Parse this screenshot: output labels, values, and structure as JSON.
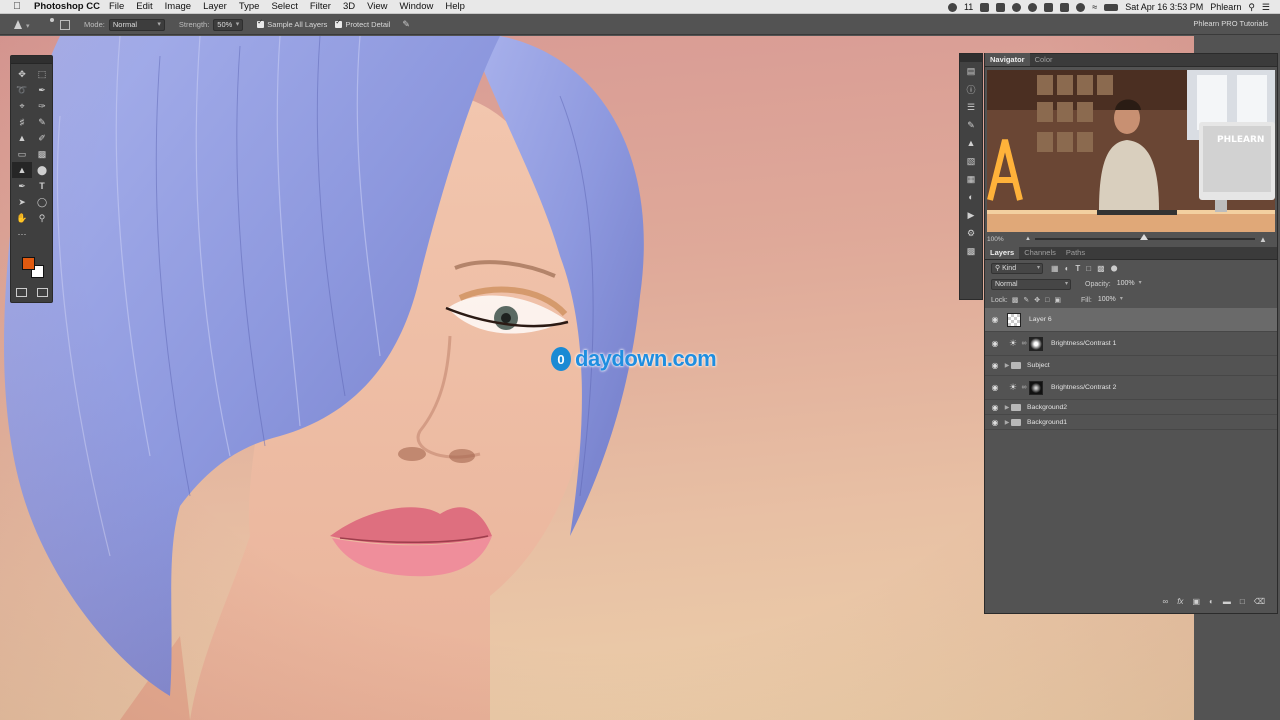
{
  "menubar": {
    "app_name": "Photoshop CC",
    "items": [
      "File",
      "Edit",
      "Image",
      "Layer",
      "Type",
      "Select",
      "Filter",
      "3D",
      "View",
      "Window",
      "Help"
    ],
    "status": {
      "count": "11",
      "datetime": "Sat Apr 16  3:53 PM",
      "user": "Phlearn"
    }
  },
  "options_bar": {
    "mode_label": "Mode:",
    "mode_value": "Normal",
    "strength_label": "Strength:",
    "strength_value": "50%",
    "sample_all_layers": "Sample All Layers",
    "protect_detail": "Protect Detail",
    "workspace": "Phlearn PRO Tutorials"
  },
  "colors": {
    "foreground": "#e15a10",
    "background": "#ffffff"
  },
  "navigator": {
    "tabs": [
      "Navigator",
      "Color"
    ],
    "active_tab": "Navigator",
    "zoom": "100%",
    "preview_text": "PHLEARN"
  },
  "layers_panel": {
    "tabs": [
      "Layers",
      "Channels",
      "Paths"
    ],
    "active_tab": "Layers",
    "filter_label": "Kind",
    "blend_mode": "Normal",
    "opacity_label": "Opacity:",
    "opacity_value": "100%",
    "lock_label": "Lock:",
    "fill_label": "Fill:",
    "fill_value": "100%",
    "layers": [
      {
        "name": "Layer 6",
        "kind": "pixel",
        "selected": true
      },
      {
        "name": "Brightness/Contrast 1",
        "kind": "adjustment",
        "selected": false
      },
      {
        "name": "Subject",
        "kind": "group",
        "selected": false
      },
      {
        "name": "Brightness/Contrast 2",
        "kind": "adjustment",
        "selected": false
      },
      {
        "name": "Background2",
        "kind": "group",
        "selected": false
      },
      {
        "name": "Background1",
        "kind": "group",
        "selected": false
      }
    ]
  },
  "watermark": {
    "badge": "0",
    "text": "daydown.com"
  }
}
